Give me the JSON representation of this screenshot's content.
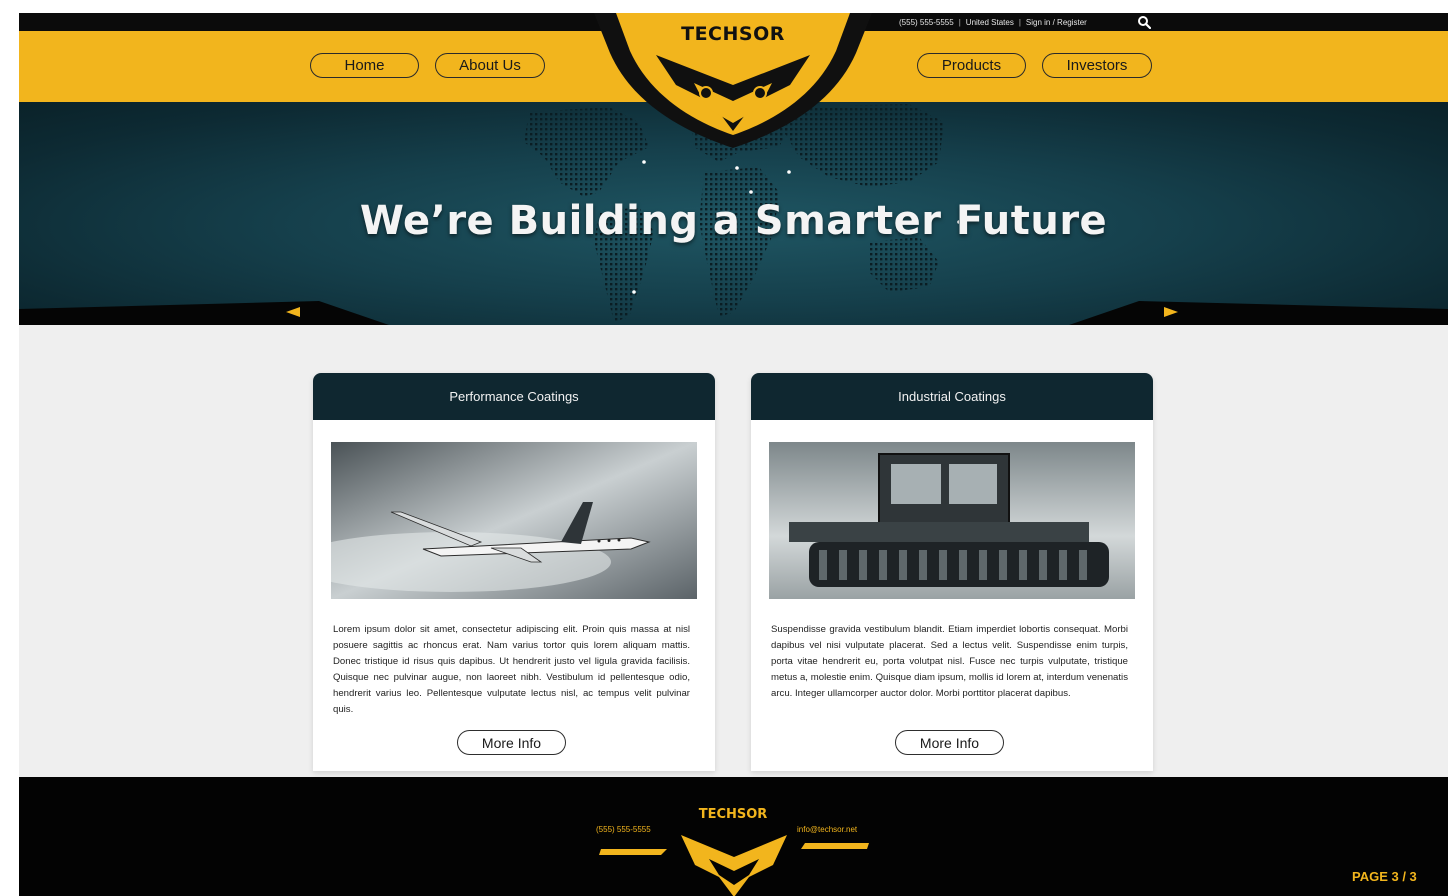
{
  "brand": {
    "name": "TECHSOR",
    "accent_color": "#f2b51d",
    "dark_color": "#0f2730"
  },
  "utility": {
    "phone": "(555) 555-5555",
    "region": "United States",
    "auth": "Sign in / Register",
    "separator": "|",
    "search_icon": "search-icon"
  },
  "nav": {
    "home": "Home",
    "about": "About Us",
    "products": "Products",
    "investors": "Investors"
  },
  "hero": {
    "title": "We’re Building a Smarter Future",
    "prev_icon": "arrow-left-icon",
    "next_icon": "arrow-right-icon"
  },
  "cards": [
    {
      "title": "Performance Coatings",
      "image": "airplane photo",
      "body": "Lorem ipsum dolor sit amet, consectetur adipiscing elit. Proin quis massa at nisl posuere sagittis ac rhoncus erat. Nam varius tortor quis lorem aliquam mattis. Donec tristique id risus quis dapibus. Ut hendrerit justo vel ligula gravida facilisis. Quisque nec pulvinar augue, non laoreet nibh. Vestibulum id pellentesque odio, hendrerit varius leo. Pellentesque vulputate lectus nisl, ac tempus velit pulvinar quis.",
      "button": "More Info"
    },
    {
      "title": "Industrial Coatings",
      "image": "snow groomer photo",
      "body": "Suspendisse gravida vestibulum blandit. Etiam imperdiet lobortis consequat. Morbi dapibus vel nisi vulputate placerat. Sed a lectus velit. Suspendisse enim turpis, porta vitae hendrerit eu, porta volutpat nisl. Fusce nec turpis vulputate, tristique metus a, molestie enim. Quisque diam ipsum, mollis id lorem at, interdum venenatis arcu. Integer ullamcorper auctor dolor. Morbi porttitor placerat dapibus.",
      "button": "More Info"
    }
  ],
  "footer": {
    "phone": "(555) 555-5555",
    "logo": "TECHSOR",
    "email": "info@techsor.net",
    "page": "PAGE 3 / 3"
  }
}
